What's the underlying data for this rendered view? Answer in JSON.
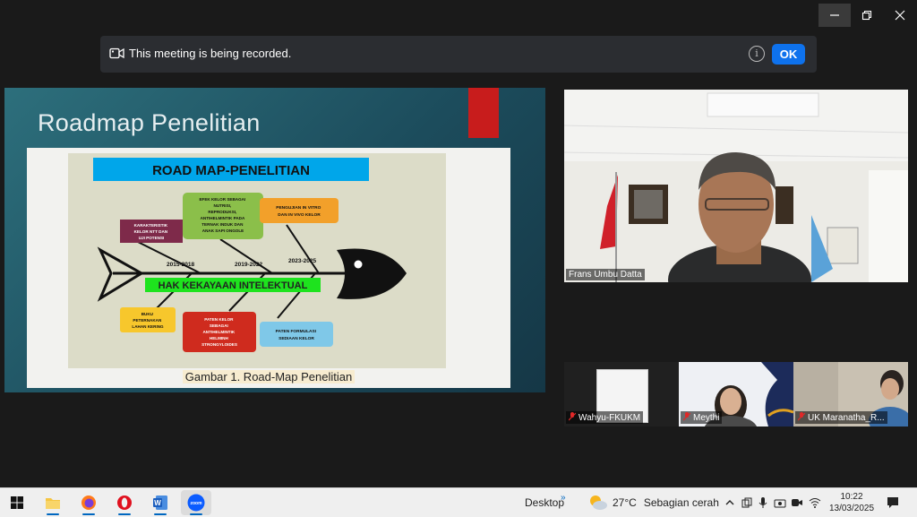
{
  "window": {
    "minimize_icon": "minimize-icon",
    "maximize_icon": "restore-icon",
    "close_icon": "close-icon"
  },
  "banner": {
    "message": "This meeting is being recorded.",
    "info_symbol": "i",
    "ok_label": "OK"
  },
  "shared_screen": {
    "slide_title": "Roadmap Penelitian",
    "header": "ROAD MAP-PENELITIAN",
    "years": [
      "2015-2018",
      "2019-2022",
      "2023-2025"
    ],
    "spine_label": "HAK KEKAYAAN INTELEKTUAL",
    "boxes": {
      "karakteristik": [
        "KARAKTERISTIK",
        "KELOR NTT DAN",
        "UJI POTENSI"
      ],
      "efek": [
        "EFEK KELOR SEBAGAI",
        "NUTRISI,",
        "REPRODUKSI,",
        "ANTIHELMINTIK PADA",
        "TERNAK INDUK DAN",
        "ANAK SAPI ONGOLE"
      ],
      "pengujian": [
        "PENGUJIAN IN VITRO",
        "DAN IN VIVO KELOR"
      ],
      "buku": [
        "BUKU",
        "PETERNAKAN",
        "LAHAN KERING"
      ],
      "paten_kelor": [
        "PATEN KELOR",
        "SEBAGAI",
        "ANTIHELMINTIK",
        "HELMINH",
        "STRONGYLOIDES"
      ],
      "paten_formulasi": [
        "PATEN FORMULASI",
        "SEDIAAN KELOR"
      ]
    },
    "caption": "Gambar 1. Road-Map Penelitian"
  },
  "participants": {
    "main": {
      "name": "Frans Umbu Datta"
    },
    "tiles": [
      {
        "name": "Wahyu-FKUKM"
      },
      {
        "name": "Meythi"
      },
      {
        "name": "UK Maranatha_R..."
      }
    ]
  },
  "taskbar": {
    "apps": [
      {
        "icon": "windows-start-icon"
      },
      {
        "icon": "file-explorer-icon"
      },
      {
        "icon": "firefox-icon"
      },
      {
        "icon": "opera-icon"
      },
      {
        "icon": "word-icon"
      },
      {
        "icon": "zoom-icon",
        "label": "zoom"
      }
    ],
    "desktop_label": "Desktop",
    "weather": {
      "temp": "27°C",
      "desc": "Sebagian cerah"
    },
    "time": "10:22",
    "date": "13/03/2025"
  },
  "colors": {
    "accent": "#0e72ed",
    "banner_bg": "#2b2d31",
    "slide_red": "#c81c1c"
  }
}
